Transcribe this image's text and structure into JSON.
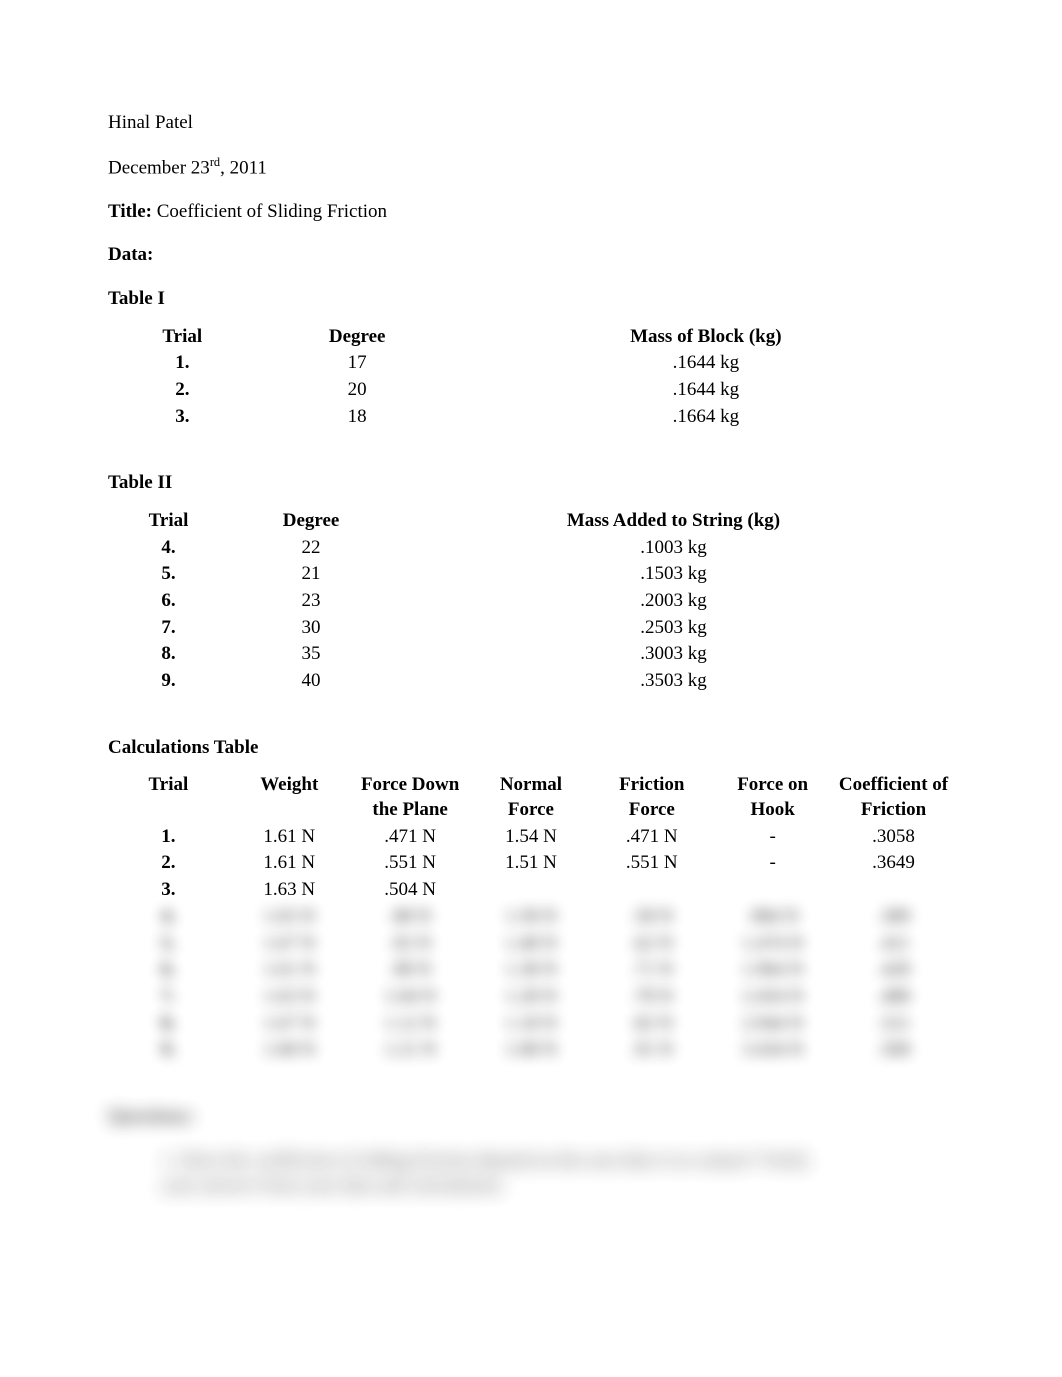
{
  "header": {
    "author": "Hinal Patel",
    "date_pre": "December 23",
    "date_sup": "rd",
    "date_post": ", 2011",
    "title_label": "Title:",
    "title_value": " Coefficient of Sliding Friction",
    "data_label": "Data:"
  },
  "table1": {
    "caption": "Table I",
    "headers": [
      "Trial",
      "Degree",
      "Mass of Block (kg)"
    ],
    "rows": [
      {
        "trial": "1.",
        "degree": "17",
        "mass": ".1644 kg"
      },
      {
        "trial": "2.",
        "degree": "20",
        "mass": ".1644 kg"
      },
      {
        "trial": "3.",
        "degree": "18",
        "mass": ".1664 kg"
      }
    ]
  },
  "table2": {
    "caption": "Table II",
    "headers": [
      "Trial",
      "Degree",
      "Mass Added to String (kg)"
    ],
    "rows": [
      {
        "trial": "4.",
        "degree": "22",
        "mass": ".1003 kg"
      },
      {
        "trial": "5.",
        "degree": "21",
        "mass": ".1503 kg"
      },
      {
        "trial": "6.",
        "degree": "23",
        "mass": ".2003 kg"
      },
      {
        "trial": "7.",
        "degree": "30",
        "mass": ".2503 kg"
      },
      {
        "trial": "8.",
        "degree": "35",
        "mass": ".3003 kg"
      },
      {
        "trial": "9.",
        "degree": "40",
        "mass": ".3503 kg"
      }
    ]
  },
  "table3": {
    "caption": "Calculations Table",
    "headers": [
      "Trial",
      "Weight",
      "Force Down the Plane",
      "Normal Force",
      "Friction Force",
      "Force on Hook",
      "Coefficient of Friction"
    ],
    "rows_clear": [
      {
        "trial": "1.",
        "weight": "1.61 N",
        "fdown": ".471 N",
        "normal": "1.54 N",
        "friction": ".471 N",
        "hook": "-",
        "coef": ".3058"
      },
      {
        "trial": "2.",
        "weight": "1.61 N",
        "fdown": ".551 N",
        "normal": "1.51 N",
        "friction": ".551 N",
        "hook": "-",
        "coef": ".3649"
      },
      {
        "trial": "3.",
        "weight": "1.63 N",
        "fdown": ".504 N",
        "normal": "",
        "friction": "",
        "hook": "",
        "coef": ""
      }
    ],
    "rows_blur": [
      {
        "c0": "4.",
        "c1": "1.65 N",
        "c2": ".88 N",
        "c3": "1.58 N",
        "c4": ".58 N",
        "c5": ".984 N",
        "c6": ".389"
      },
      {
        "c0": "5.",
        "c1": "1.67 N",
        "c2": ".92 N",
        "c3": "1.48 N",
        "c4": ".62 N",
        "c5": "1.474 N",
        "c6": ".411"
      },
      {
        "c0": "6.",
        "c1": "1.61 N",
        "c2": ".98 N",
        "c3": "1.38 N",
        "c4": ".71 N",
        "c5": "1.964 N",
        "c6": ".428"
      },
      {
        "c0": "7.",
        "c1": "1.63 N",
        "c2": "1.04 N",
        "c3": "1.28 N",
        "c4": ".78 N",
        "c5": "2.454 N",
        "c6": ".488"
      },
      {
        "c0": "8.",
        "c1": "1.67 N",
        "c2": "1.12 N",
        "c3": "1.18 N",
        "c4": ".82 N",
        "c5": "2.944 N",
        "c6": ".521"
      },
      {
        "c0": "9.",
        "c1": "1.68 N",
        "c2": "1.21 N",
        "c3": "1.08 N",
        "c4": ".91 N",
        "c5": "3.434 N",
        "c6": ".568"
      }
    ]
  },
  "questions": {
    "heading": "Questions:",
    "item_num": "1.",
    "item_text_l1": "Does the coefficient of sliding friction depend on the area that is in contact? Verify",
    "item_text_l2": "your answer from your data and calculations."
  }
}
